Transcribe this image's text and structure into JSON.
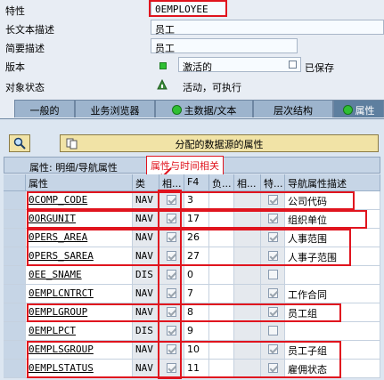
{
  "header": {
    "rows": [
      {
        "label": "特性",
        "value": "0EMPLOYEE"
      },
      {
        "label": "长文本描述",
        "value": "员工"
      },
      {
        "label": "简要描述",
        "value": "员工"
      },
      {
        "label": "版本",
        "value": "激活的",
        "suffix": "已保存"
      },
      {
        "label": "对象状态",
        "value": "活动，可执行"
      }
    ]
  },
  "tabs": [
    {
      "label": "一般的"
    },
    {
      "label": "业务浏览器"
    },
    {
      "label": "主数据/文本"
    },
    {
      "label": "层次结构"
    },
    {
      "label": "属性"
    }
  ],
  "toolbar": {
    "button_label": "分配的数据源的属性"
  },
  "section": {
    "title": "属性: 明细/导航属性",
    "callout": "属性与时间相关"
  },
  "table": {
    "headers": [
      "属性",
      "类",
      "相...",
      "F4",
      "负...",
      "相...",
      "特...",
      "导航属性描述"
    ],
    "rows": [
      {
        "attr": "0COMP_CODE",
        "cls": "NAV",
        "time": true,
        "f4": "3",
        "nav": true,
        "desc": "公司代码"
      },
      {
        "attr": "0ORGUNIT",
        "cls": "NAV",
        "time": true,
        "f4": "17",
        "nav": true,
        "desc": "组织单位"
      },
      {
        "attr": "0PERS_AREA",
        "cls": "NAV",
        "time": true,
        "f4": "26",
        "nav": true,
        "desc": "人事范围"
      },
      {
        "attr": "0PERS_SAREA",
        "cls": "NAV",
        "time": true,
        "f4": "27",
        "nav": true,
        "desc": "人事子范围"
      },
      {
        "attr": "0EE_SNAME",
        "cls": "DIS",
        "time": true,
        "f4": "0",
        "nav": false,
        "desc": ""
      },
      {
        "attr": "0EMPLCNTRCT",
        "cls": "NAV",
        "time": true,
        "f4": "7",
        "nav": true,
        "desc": "工作合同"
      },
      {
        "attr": "0EMPLGROUP",
        "cls": "NAV",
        "time": true,
        "f4": "8",
        "nav": true,
        "desc": "员工组"
      },
      {
        "attr": "0EMPLPCT",
        "cls": "DIS",
        "time": true,
        "f4": "9",
        "nav": false,
        "desc": ""
      },
      {
        "attr": "0EMPLSGROUP",
        "cls": "NAV",
        "time": true,
        "f4": "10",
        "nav": true,
        "desc": "员工子组"
      },
      {
        "attr": "0EMPLSTATUS",
        "cls": "NAV",
        "time": true,
        "f4": "11",
        "nav": true,
        "desc": "雇佣状态"
      }
    ]
  },
  "colors": {
    "highlight": "#e0141e",
    "status_green": "#2fbf33"
  },
  "icons": [
    "dropdown-icon",
    "status-active-icon",
    "object-status-icon",
    "search-icon",
    "attributes-icon"
  ]
}
